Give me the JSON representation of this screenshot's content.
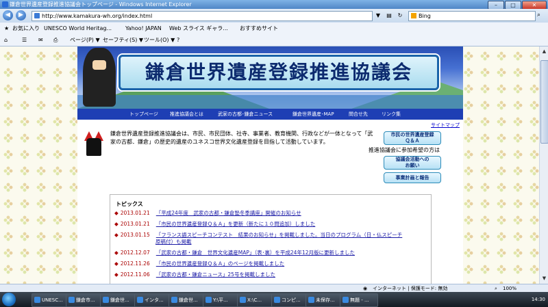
{
  "window": {
    "title": "鎌倉世界遺産登録推進協議会トップページ - Windows Internet Explorer",
    "min": "–",
    "max": "□",
    "close": "✕"
  },
  "address": {
    "back": "◀",
    "forward": "▶",
    "url": "http://www.kamakura-wh.org/index.html",
    "search_text": "Bing",
    "search_icon": "⌕"
  },
  "favorites": {
    "label": "お気に入り",
    "items": [
      "UNESCO World Heritag...",
      "Yahoo! JAPAN",
      "Web スライス ギャラ...",
      "おすすめサイト"
    ]
  },
  "command": {
    "home": "⌂",
    "feeds": "☰",
    "mail": "✉",
    "print": "⎙",
    "items": [
      "ページ(P) ▼",
      "セーフティ(S) ▼",
      "ツール(O) ▼",
      "?"
    ]
  },
  "banner": {
    "title": "鎌倉世界遺産登録推進協議会"
  },
  "nav": {
    "items": [
      "トップページ",
      "推進協議会とは",
      "武家の古都･鎌倉ニュース",
      "鎌倉世界遺産･MAP",
      "問合せ先",
      "リンク集"
    ]
  },
  "sitemap": "サイトマップ",
  "intro": "鎌倉世界遺産登録推進協議会は、市民、市民団体、社寺、事業者、教育機関、行政などが一体となって「武家の古都．鎌倉」の歴史的遺産のユネスコ世界文化遺産登録を目指して活動しています。",
  "side": {
    "qa_line1": "市民の世界遺産登録",
    "qa_line2": "Ｑ＆Ａ",
    "join_label": "推進協議会に参加希望の方は",
    "act_line1": "協議会活動への",
    "act_line2": "お願い",
    "plan": "事業計画と報告"
  },
  "topics": {
    "heading": "トピックス",
    "items": [
      {
        "date": "2013.01.21",
        "text": "「平成24年度　武家の古都・鎌倉塾冬季講座」開催のお知らせ"
      },
      {
        "date": "2013.01.21",
        "text": "「市民の世界遺産登録Ｑ＆Ａ」を更新（新たに１０問追加）しました"
      },
      {
        "date": "2013.01.15",
        "text": "「フランス語スピーチコンテスト　結果のお知らせ」を掲載しました。当日のプログラム（日・仏スピーチ",
        "text2": "原稿付）も掲載"
      },
      {
        "date": "2012.12.07",
        "text": "「武家の古都・鎌倉　世界文化遺産MAP」（表･裏）を平成24年12月版に更新しました"
      },
      {
        "date": "2012.11.26",
        "text": "「市民の世界遺産登録Ｑ＆Ａ」のページを掲載しました"
      },
      {
        "date": "2012.11.06",
        "text": "「武家の古都・鎌倉ニュース」25号を掲載しました"
      }
    ]
  },
  "status": {
    "zone": "インターネット | 保護モード: 無効",
    "zoom": "100%"
  },
  "taskbar": {
    "items": [
      "UNESC...",
      "鎌倉市...",
      "鎌倉世...",
      "インタ...",
      "鎌倉世...",
      "Y:\\平...",
      "X:\\C...",
      "コンピ...",
      "未保存...",
      "無題 - ..."
    ],
    "clock": "14:30"
  }
}
